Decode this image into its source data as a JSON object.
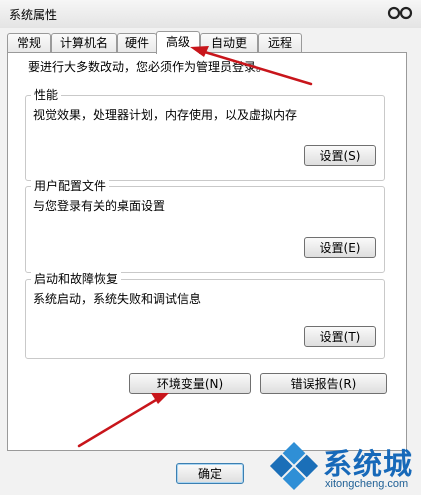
{
  "window": {
    "title": "系统属性",
    "close_icon": "close-icon"
  },
  "tabs": [
    {
      "label": "常规",
      "active": false
    },
    {
      "label": "计算机名",
      "active": false
    },
    {
      "label": "硬件",
      "active": false
    },
    {
      "label": "高级",
      "active": true
    },
    {
      "label": "自动更新",
      "active": false
    },
    {
      "label": "远程",
      "active": false
    }
  ],
  "advanced": {
    "admin_note": "要进行大多数改动，您必须作为管理员登录。",
    "performance": {
      "title": "性能",
      "description": "视觉效果，处理器计划，内存使用，以及虚拟内存",
      "button": "设置(S)"
    },
    "user_profiles": {
      "title": "用户配置文件",
      "description": "与您登录有关的桌面设置",
      "button": "设置(E)"
    },
    "startup_recovery": {
      "title": "启动和故障恢复",
      "description": "系统启动，系统失败和调试信息",
      "button": "设置(T)"
    },
    "env_button": "环境变量(N)",
    "error_report_button": "错误报告(R)"
  },
  "footer": {
    "ok_button": "确定"
  },
  "watermark": {
    "brand": "系统城",
    "domain": "xitongcheng.com"
  },
  "colors": {
    "annotation_arrow": "#c8151b",
    "watermark_blue": "#1769b9",
    "focus_border": "#3c7fb1"
  }
}
